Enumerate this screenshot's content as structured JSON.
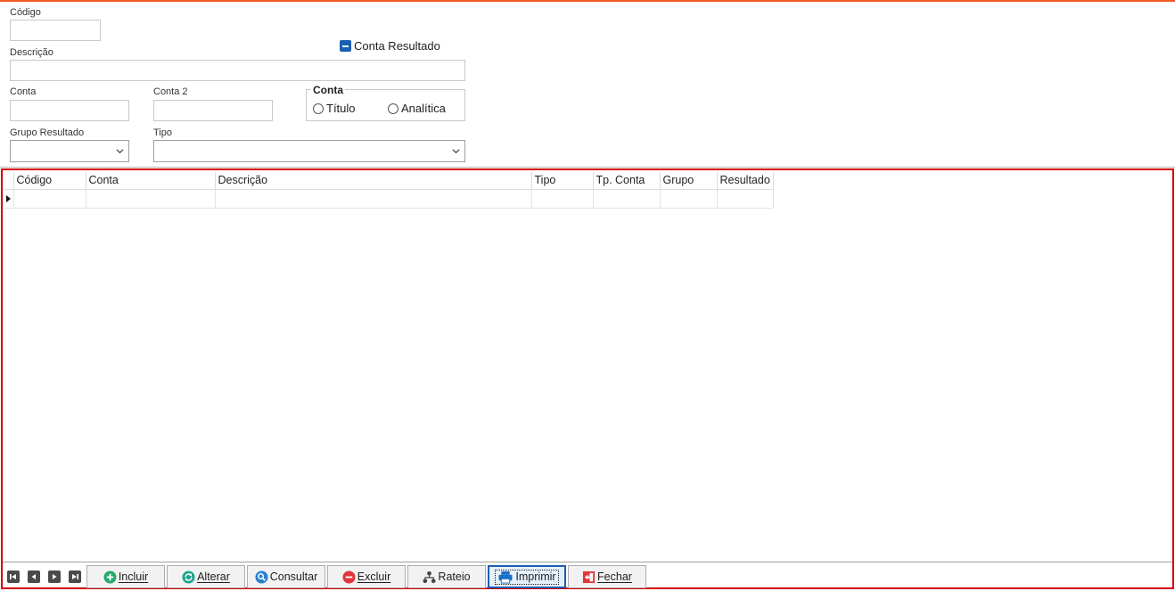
{
  "form": {
    "codigo_label": "Código",
    "descricao_label": "Descrição",
    "conta_label": "Conta",
    "conta2_label": "Conta 2",
    "grupo_resultado_label": "Grupo Resultado",
    "tipo_label": "Tipo",
    "conta_resultado_checkbox": "Conta Resultado",
    "conta_group": {
      "legend": "Conta",
      "options": [
        "Título",
        "Analítica"
      ]
    }
  },
  "grid": {
    "columns": [
      "Código",
      "Conta",
      "Descrição",
      "Tipo",
      "Tp. Conta",
      "Grupo",
      "Resultado"
    ]
  },
  "toolbar": {
    "buttons": [
      {
        "label": "Incluir",
        "icon": "plus-circle-icon"
      },
      {
        "label": "Alterar",
        "icon": "refresh-icon"
      },
      {
        "label": "Consultar",
        "icon": "search-icon"
      },
      {
        "label": "Excluir",
        "icon": "minus-circle-icon"
      },
      {
        "label": "Rateio",
        "icon": "hierarchy-icon"
      },
      {
        "label": "Imprimir",
        "icon": "printer-icon"
      },
      {
        "label": "Fechar",
        "icon": "exit-icon"
      }
    ],
    "nav_icons": [
      "first-record-icon",
      "prev-record-icon",
      "next-record-icon",
      "last-record-icon"
    ]
  },
  "colors": {
    "accent": "#f05a22",
    "frame": "#d40000",
    "checkbox": "#1a5fb4"
  }
}
